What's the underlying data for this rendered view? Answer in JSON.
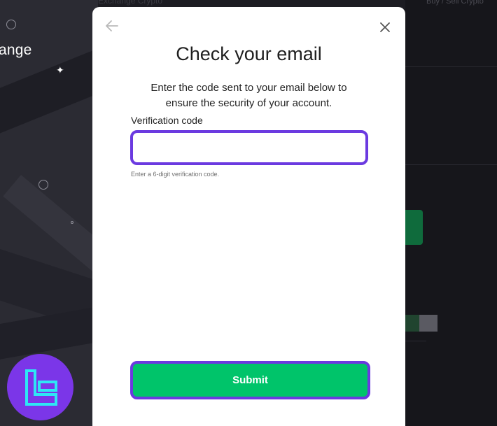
{
  "background": {
    "promo_title": "ange",
    "ghost_top_left": "Exchange Crypto",
    "ghost_top_right": "Buy / Sell Crypto"
  },
  "modal": {
    "title": "Check your email",
    "description": "Enter the code sent to your email below to ensure the security of your account.",
    "field_label": "Verification code",
    "field_value": "",
    "field_placeholder": "",
    "hint": "Enter a 6-digit verification code.",
    "submit_label": "Submit",
    "back_icon": "arrow-left-icon",
    "close_icon": "close-icon"
  },
  "colors": {
    "accent_purple": "#6b3ae0",
    "submit_green": "#00c46a",
    "logo_purple": "#7b36e8",
    "logo_cyan": "#2ee6f5"
  }
}
